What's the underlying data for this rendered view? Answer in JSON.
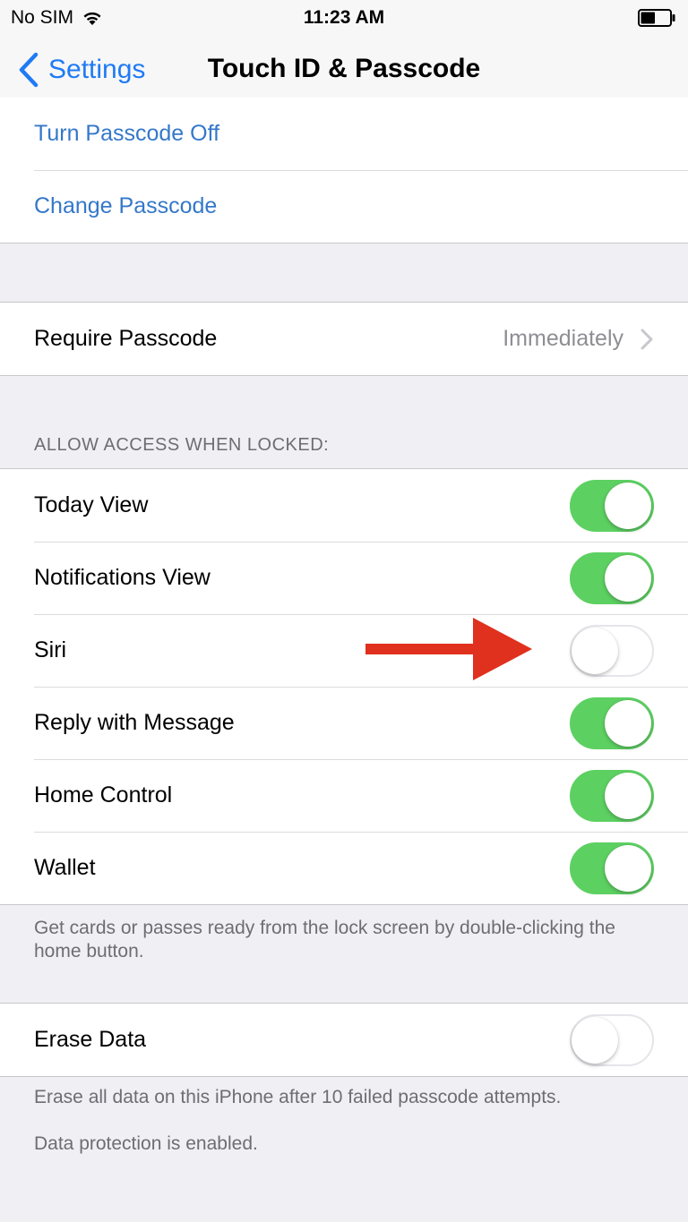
{
  "status_bar": {
    "carrier": "No SIM",
    "time": "11:23 AM",
    "wifi_icon": "wifi-icon",
    "battery_icon": "battery-icon",
    "battery_level": 0.5
  },
  "nav": {
    "back_label": "Settings",
    "title": "Touch ID & Passcode"
  },
  "passcode_group": {
    "turn_off": "Turn Passcode Off",
    "change": "Change Passcode"
  },
  "require_group": {
    "label": "Require Passcode",
    "value": "Immediately"
  },
  "allow_access": {
    "header": "ALLOW ACCESS WHEN LOCKED:",
    "items": [
      {
        "label": "Today View",
        "on": true
      },
      {
        "label": "Notifications View",
        "on": true
      },
      {
        "label": "Siri",
        "on": false
      },
      {
        "label": "Reply with Message",
        "on": true
      },
      {
        "label": "Home Control",
        "on": true
      },
      {
        "label": "Wallet",
        "on": true
      }
    ],
    "footer": "Get cards or passes ready from the lock screen by double-clicking the home button."
  },
  "erase_group": {
    "label": "Erase Data",
    "on": false,
    "footer1": "Erase all data on this iPhone after 10 failed passcode attempts.",
    "footer2": "Data protection is enabled."
  },
  "colors": {
    "accent_blue": "#1f7bf5",
    "switch_on": "#5dd062",
    "annotation_arrow": "#e0301e"
  }
}
